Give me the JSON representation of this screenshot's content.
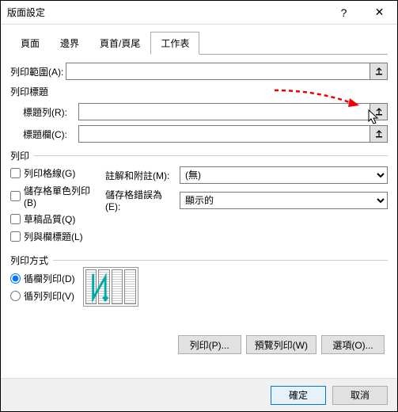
{
  "title": "版面設定",
  "tabs": {
    "t0": "頁面",
    "t1": "邊界",
    "t2": "頁首/頁尾",
    "t3": "工作表"
  },
  "print_area": {
    "label": "列印範圍(A):",
    "value": ""
  },
  "print_titles_hdr": "列印標題",
  "title_rows": {
    "label": "標題列(R):",
    "value": ""
  },
  "title_cols": {
    "label": "標題欄(C):",
    "value": ""
  },
  "print_legend": "列印",
  "chk": {
    "grid": "列印格線(G)",
    "bw": "儲存格單色列印(B)",
    "draft": "草稿品質(Q)",
    "rowcol": "列與欄標題(L)"
  },
  "comments": {
    "label": "註解和附註(M):",
    "value": "(無)"
  },
  "errors": {
    "label": "儲存格錯誤為(E):",
    "value": "顯示的"
  },
  "order_legend": "列印方式",
  "order": {
    "down": "循欄列印(D)",
    "over": "循列列印(V)"
  },
  "btns": {
    "print": "列印(P)...",
    "preview": "預覽列印(W)",
    "options": "選項(O)..."
  },
  "footer": {
    "ok": "確定",
    "cancel": "取消"
  }
}
